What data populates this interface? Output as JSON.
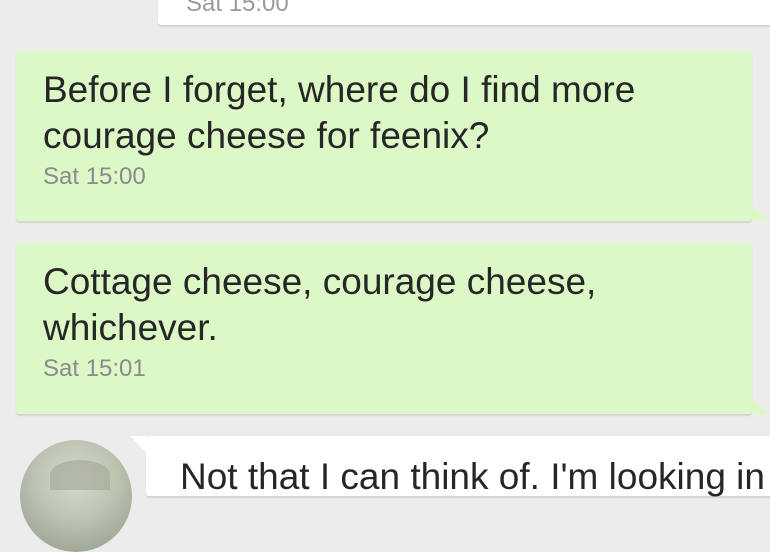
{
  "chat": {
    "previous_message": {
      "timestamp": "Sat 15:00"
    },
    "messages": [
      {
        "text": "Before I forget, where do I find more\ncourage cheese for feenix?",
        "timestamp": "Sat 15:00"
      },
      {
        "text": "Cottage cheese, courage cheese,\nwhichever.",
        "timestamp": "Sat 15:01"
      }
    ],
    "incoming_message": {
      "text": "Not that I can think of. I'm looking in"
    }
  },
  "colors": {
    "background": "#ececec",
    "outgoing_bubble": "#dcf8c6",
    "incoming_bubble": "#ffffff",
    "timestamp": "#8b8b8b"
  },
  "icons": {
    "avatar": "contact-avatar"
  }
}
